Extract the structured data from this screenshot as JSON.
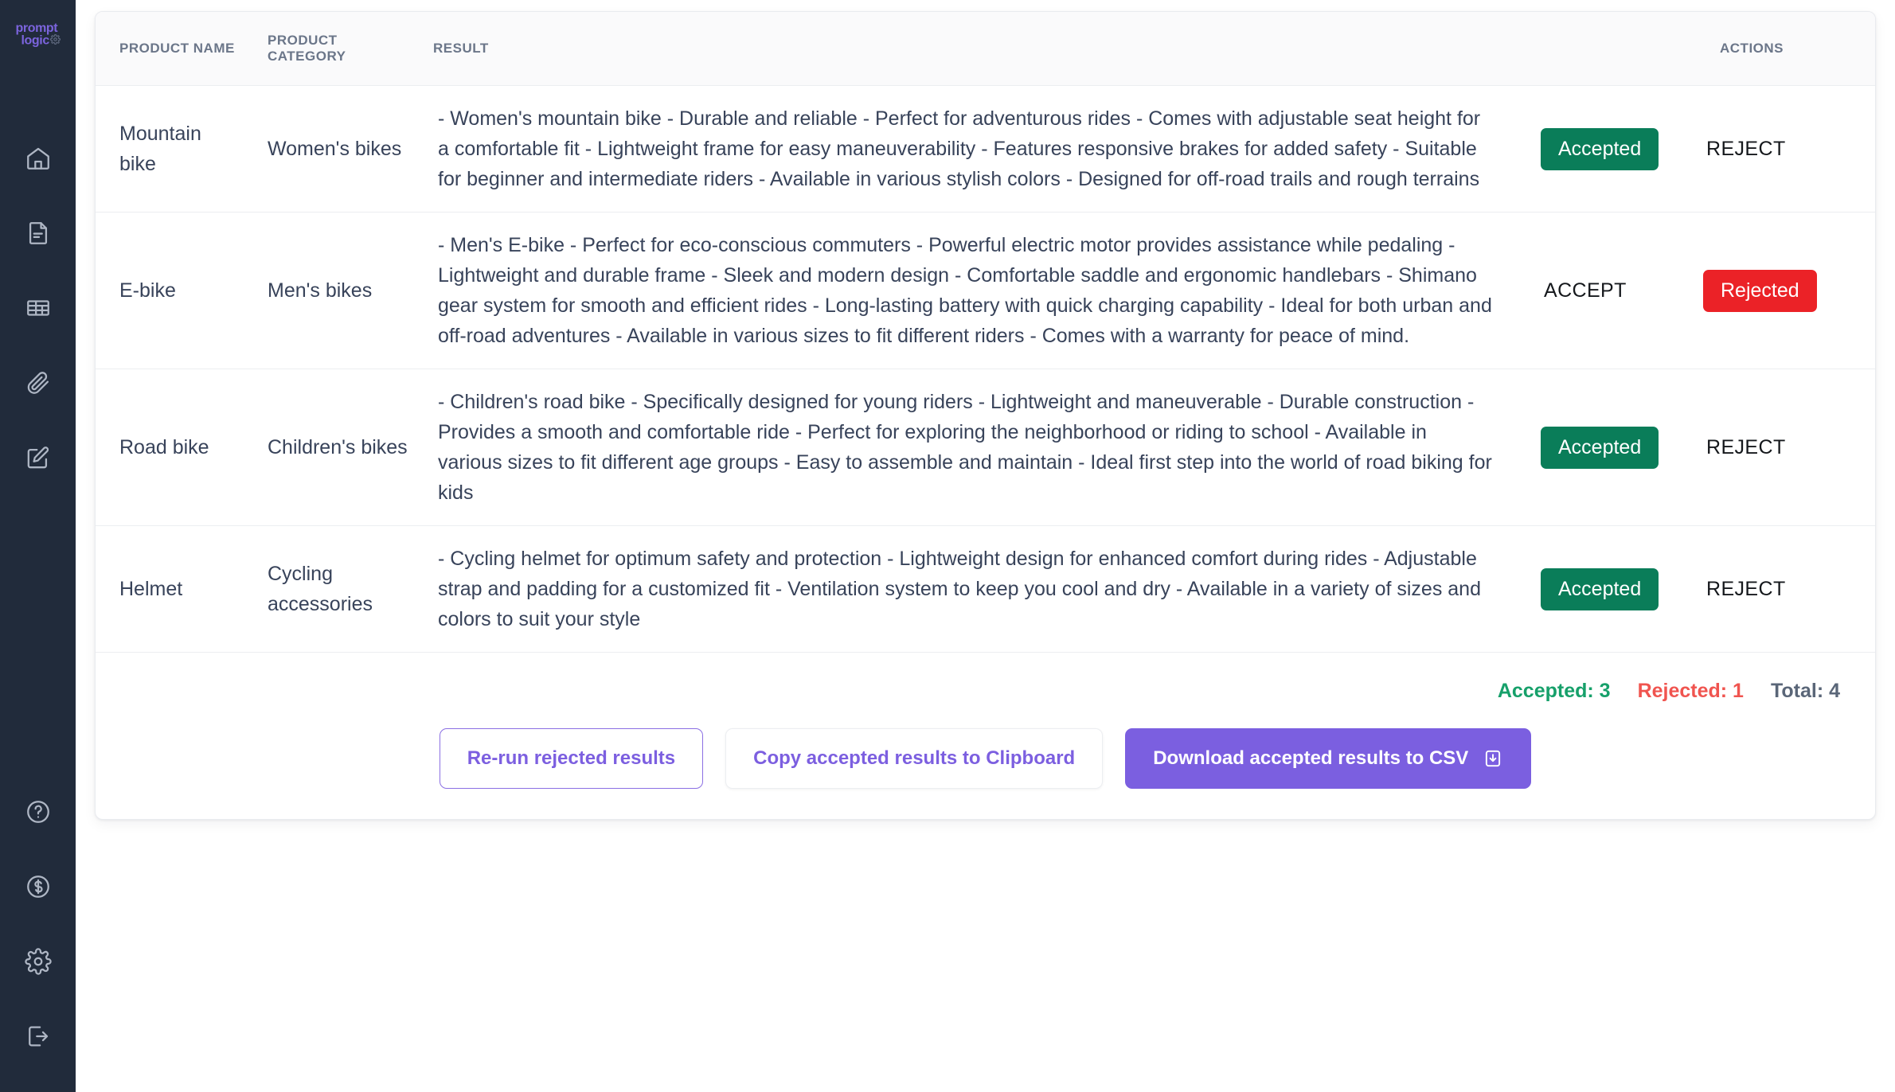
{
  "sidebar": {
    "logo": {
      "line1": "prompt",
      "line2": "logic",
      "gear_icon": "gear-icon"
    },
    "top_items": [
      {
        "icon": "home-icon",
        "name": "home"
      },
      {
        "icon": "document-icon",
        "name": "documents"
      },
      {
        "icon": "table-icon",
        "name": "tables"
      },
      {
        "icon": "paperclip-icon",
        "name": "attachments"
      },
      {
        "icon": "edit-square-icon",
        "name": "edit"
      }
    ],
    "bottom_items": [
      {
        "icon": "help-circle-icon",
        "name": "help"
      },
      {
        "icon": "dollar-circle-icon",
        "name": "billing"
      },
      {
        "icon": "gear-icon",
        "name": "settings"
      },
      {
        "icon": "logout-icon",
        "name": "logout"
      }
    ]
  },
  "table": {
    "headers": {
      "product_name": "PRODUCT NAME",
      "product_category_line1": "PRODUCT",
      "product_category_line2": "CATEGORY",
      "result": "RESULT",
      "actions": "ACTIONS"
    },
    "rows": [
      {
        "product_name": "Mountain bike",
        "product_category": "Women's bikes",
        "result": "- Women's mountain bike - Durable and reliable - Perfect for adventurous rides - Comes with adjustable seat height for a comfortable fit - Lightweight frame for easy maneuverability - Features responsive brakes for added safety - Suitable for beginner and intermediate riders - Available in various stylish colors - Designed for off-road trails and rough terrains",
        "state": "accepted",
        "accept_label": "Accepted",
        "reject_label": "REJECT"
      },
      {
        "product_name": "E-bike",
        "product_category": "Men's bikes",
        "result": "- Men's E-bike - Perfect for eco-conscious commuters - Powerful electric motor provides assistance while pedaling - Lightweight and durable frame - Sleek and modern design - Comfortable saddle and ergonomic handlebars - Shimano gear system for smooth and efficient rides - Long-lasting battery with quick charging capability - Ideal for both urban and off-road adventures - Available in various sizes to fit different riders - Comes with a warranty for peace of mind.",
        "state": "rejected",
        "accept_label": "ACCEPT",
        "reject_label": "Rejected"
      },
      {
        "product_name": "Road bike",
        "product_category": "Children's bikes",
        "result": "- Children's road bike - Specifically designed for young riders - Lightweight and maneuverable - Durable construction - Provides a smooth and comfortable ride - Perfect for exploring the neighborhood or riding to school - Available in various sizes to fit different age groups - Easy to assemble and maintain - Ideal first step into the world of road biking for kids",
        "state": "accepted",
        "accept_label": "Accepted",
        "reject_label": "REJECT"
      },
      {
        "product_name": "Helmet",
        "product_category": "Cycling accessories",
        "result": "- Cycling helmet for optimum safety and protection - Lightweight design for enhanced comfort during rides - Adjustable strap and padding for a customized fit - Ventilation system to keep you cool and dry - Available in a variety of sizes and colors to suit your style",
        "state": "accepted",
        "accept_label": "Accepted",
        "reject_label": "REJECT"
      }
    ]
  },
  "footer": {
    "stats": {
      "accepted": "Accepted: 3",
      "rejected": "Rejected: 1",
      "total": "Total: 4"
    },
    "buttons": {
      "rerun": "Re-run rejected results",
      "copy": "Copy accepted results to Clipboard",
      "download": "Download accepted results to CSV",
      "download_icon": "download-icon"
    }
  },
  "colors": {
    "accent_purple": "#7b5fe0",
    "accepted_green": "#0a7d59",
    "rejected_red": "#eb2227",
    "stat_green": "#16a06a",
    "stat_red": "#f0544f",
    "sidebar_bg": "#212b3b"
  }
}
